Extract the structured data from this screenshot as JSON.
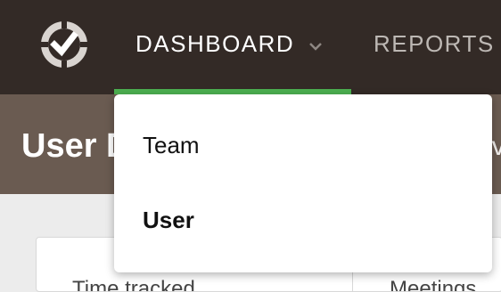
{
  "nav": {
    "dashboard_label": "DASHBOARD",
    "reports_label": "REPORTS",
    "active_color": "#4caf50"
  },
  "icons": {
    "logo": "check-badge-icon",
    "dropdown": "chevron-down-icon"
  },
  "header": {
    "title": "User D",
    "right_fragment": "ev"
  },
  "dropdown": {
    "items": [
      {
        "label": "Team",
        "selected": false
      },
      {
        "label": "User",
        "selected": true
      }
    ]
  },
  "card": {
    "left_label": "Time tracked",
    "right_label": "Meetings"
  },
  "colors": {
    "topbar": "#332a26",
    "header": "#6a5b51",
    "content": "#ececec",
    "dropdown": "#ffffff"
  }
}
